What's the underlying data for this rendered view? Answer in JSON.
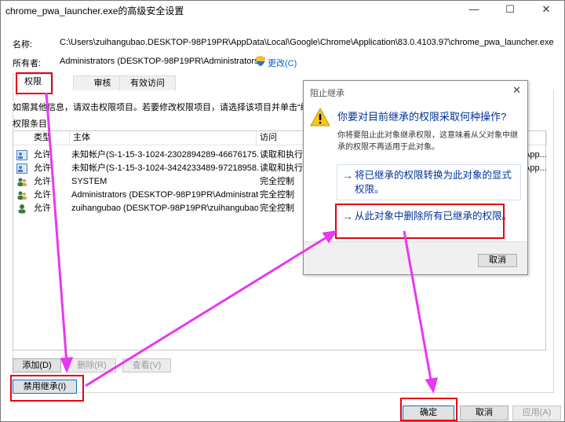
{
  "window": {
    "title": "chrome_pwa_launcher.exe的高级安全设置",
    "minimize": "—",
    "maximize": "☐",
    "close": "✕"
  },
  "info": {
    "name_label": "名称:",
    "name_value": "C:\\Users\\zuihangubao.DESKTOP-98P19PR\\AppData\\Local\\Google\\Chrome\\Application\\83.0.4103.97\\chrome_pwa_launcher.exe",
    "owner_label": "所有者:",
    "owner_value": "Administrators (DESKTOP-98P19PR\\Administrators)",
    "change_link": "更改(C)"
  },
  "tabs": [
    "权限",
    "审核",
    "有效访问"
  ],
  "panel": {
    "instructions": "如需其他信息，请双击权限项目。若要修改权限项目，请选择该项目并单击“编辑",
    "entries_label": "权限条目:"
  },
  "table": {
    "columns": [
      "类型",
      "主体",
      "访问"
    ],
    "rows": [
      {
        "type": "允许",
        "principal": "未知帐户(S-1-15-3-1024-2302894289-46676175...",
        "access": "读取和执行",
        "extra": "App..."
      },
      {
        "type": "允许",
        "principal": "未知帐户(S-1-15-3-1024-3424233489-97218958...",
        "access": "读取和执行",
        "extra": "App..."
      },
      {
        "type": "允许",
        "principal": "SYSTEM",
        "access": "完全控制",
        "extra": ""
      },
      {
        "type": "允许",
        "principal": "Administrators (DESKTOP-98P19PR\\Administrat...",
        "access": "完全控制",
        "extra": ""
      },
      {
        "type": "允许",
        "principal": "zuihangubao (DESKTOP-98P19PR\\zuihangubao)",
        "access": "完全控制",
        "extra": ""
      }
    ]
  },
  "buttons": {
    "add": "添加(D)",
    "remove": "删除(R)",
    "view": "查看(V)",
    "disable_inheritance": "禁用继承(I)",
    "ok": "确定",
    "cancel": "取消",
    "apply": "应用(A)"
  },
  "dialog": {
    "title": "阻止继承",
    "close": "✕",
    "question": "你要对目前继承的权限采取何种操作?",
    "description": "你将要阻止此对象继承权限，这意味着从父对象中继承的权限不再适用于此对象。",
    "option1": "将已继承的权限转换为此对象的显式权限。",
    "option2": "从此对象中删除所有已继承的权限。",
    "option_arrow": "→",
    "cancel": "取消"
  },
  "colors": {
    "annotation_red": "#e60012",
    "annotation_magenta": "#e838f0",
    "link_blue": "#003399"
  }
}
